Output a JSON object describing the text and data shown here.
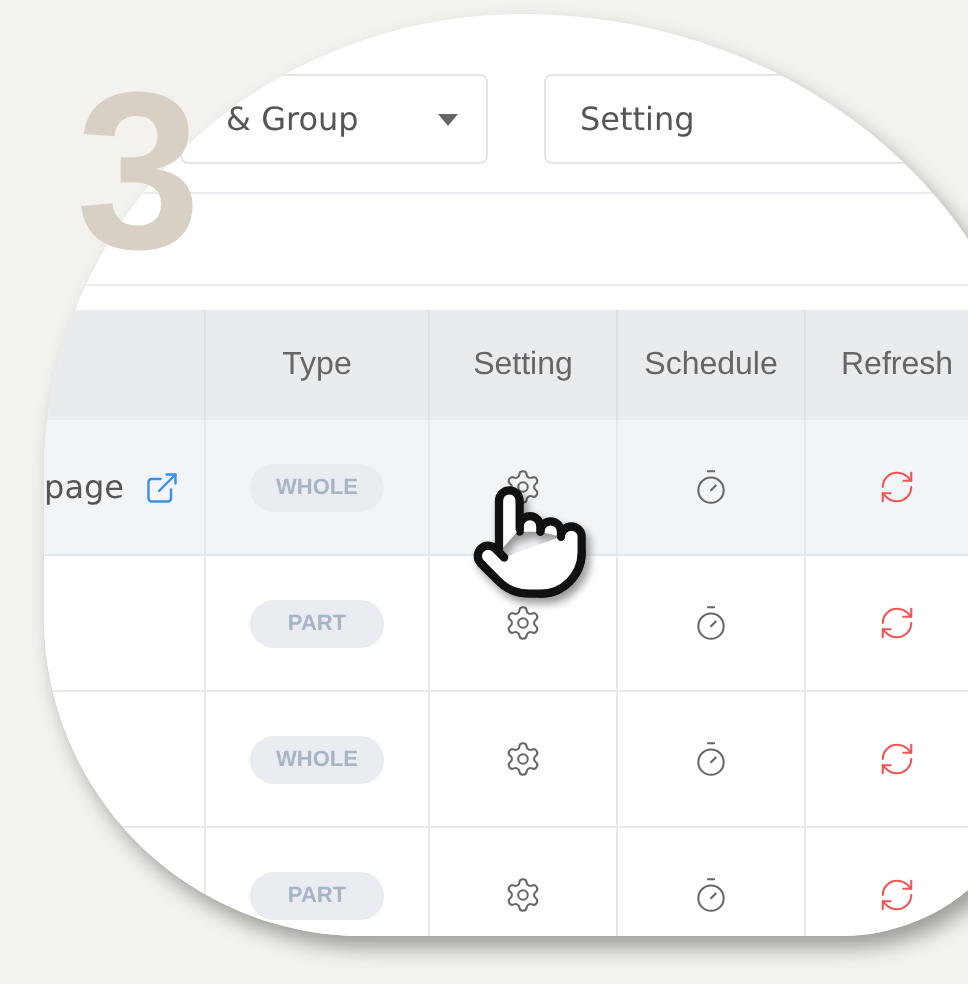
{
  "step_number": "3",
  "filters": [
    {
      "kind": "dropdown",
      "value": "& Group"
    },
    {
      "kind": "field",
      "value": "Setting"
    }
  ],
  "table": {
    "columns": [
      "Type",
      "Setting",
      "Schedule",
      "Refresh"
    ],
    "rows": [
      {
        "column_1": "page",
        "link": true,
        "type": "WHOLE",
        "selected": true
      },
      {
        "type": "PART",
        "selected": false
      },
      {
        "type": "WHOLE",
        "selected": false
      },
      {
        "type": "PART",
        "selected": false
      }
    ]
  }
}
